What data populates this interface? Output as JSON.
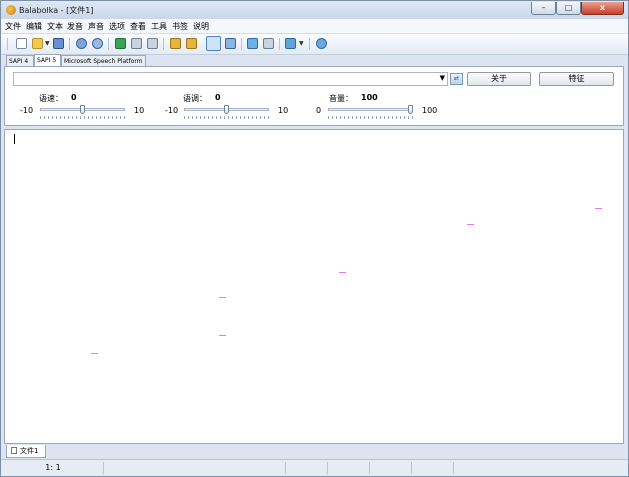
{
  "window": {
    "title": "Balabolka - [文件1]"
  },
  "menu": [
    "文件",
    "编辑",
    "文本",
    "发音",
    "声音",
    "选项",
    "查看",
    "工具",
    "书签",
    "说明"
  ],
  "toolbar_icons": [
    "new-document-icon",
    "open-folder-icon",
    "dropdown-arrow-icon",
    "save-icon",
    "read-aloud-icon",
    "read-clipboard-icon",
    "play-icon",
    "pause-icon",
    "stop-icon",
    "save-audio-icon",
    "split-file-icon",
    "text-edit-icon",
    "batch-convert-icon",
    "speech-to-file-icon",
    "export-icon",
    "voice-settings-icon",
    "dropdown-arrow-icon",
    "help-icon"
  ],
  "tabs": [
    "SAPI 4",
    "SAPI 5",
    "Microsoft Speech Platform"
  ],
  "voice_panel": {
    "about_button": "关于",
    "properties_button": "特征",
    "rate": {
      "label": "语速：",
      "value": "0",
      "min": "-10",
      "max": "10",
      "level": 0.5
    },
    "pitch": {
      "label": "语调：",
      "value": "0",
      "min": "-10",
      "max": "10",
      "level": 0.5
    },
    "volume": {
      "label": "音量：",
      "value": "100",
      "min": "0",
      "max": "100",
      "level": 1.0
    }
  },
  "document_tab": "文件1",
  "status": {
    "cursor": "1:   1"
  },
  "colors": {
    "close_button": "#c7402a",
    "panel_border": "#9aa8bb",
    "window_frame": "#dbe4f0"
  }
}
